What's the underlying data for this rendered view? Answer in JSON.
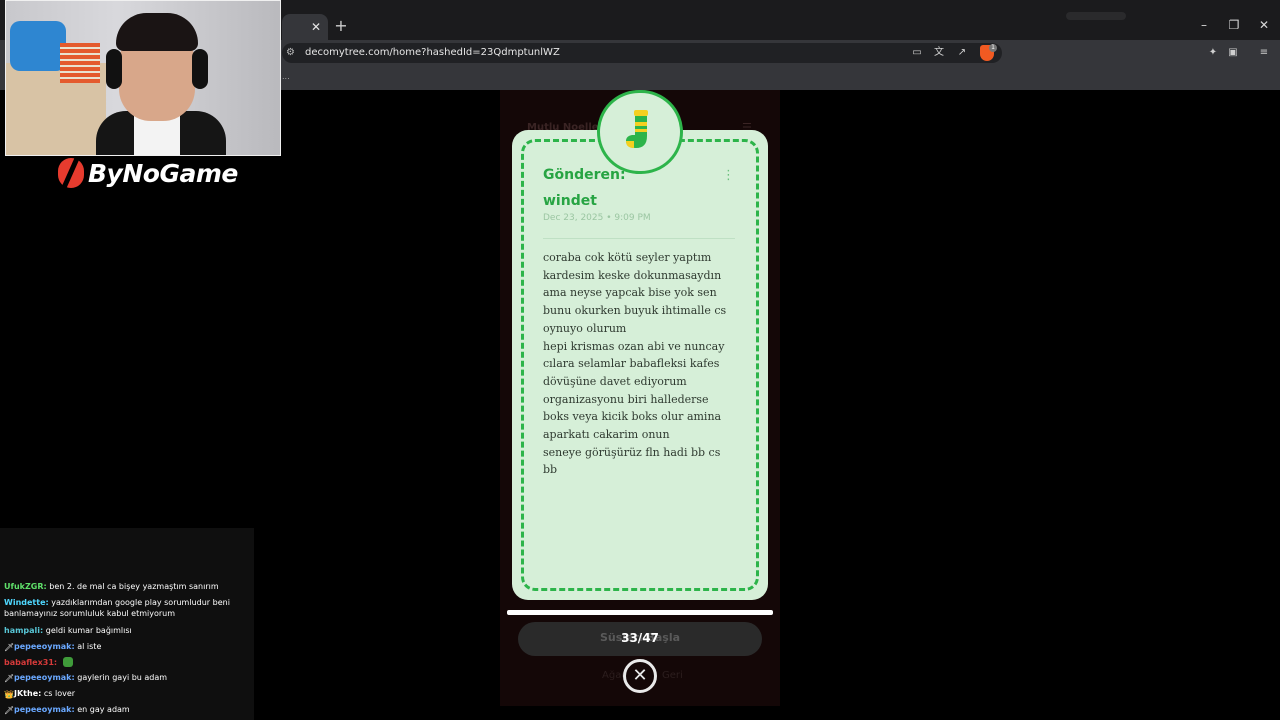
{
  "browser": {
    "tab_close": "✕",
    "new_tab": "+",
    "window_buttons": {
      "minimize": "–",
      "maximize": "❐",
      "close": "✕"
    },
    "url": "decomytree.com/home?hashedId=23QdmptunlWZ",
    "site_info_icon": "tune-icon",
    "toolbar_icons": [
      "cast-icon",
      "translate-icon",
      "share-icon",
      "brave-shield-icon",
      "extensions-icon",
      "sidebar-icon",
      "menu-icon"
    ],
    "brave_badge": "1",
    "bookmark_glyph": "..."
  },
  "page": {
    "faded_title": "Mutlu Noeller",
    "faded_menu": "☰",
    "card": {
      "sender_label": "Gönderen:",
      "sender_name": "windet",
      "timestamp": "Dec 23, 2025 • 9:09 PM",
      "menu": "⋮",
      "icon": "sock-icon",
      "message_lines": [
        "coraba cok kötü seyler yaptım",
        "kardesim keske dokunmasaydın",
        "ama neyse yapcak bise yok sen",
        "bunu okurken buyuk ihtimalle cs",
        "oynuyo olurum",
        "hepi krismas ozan abi ve nuncay",
        "cılara selamlar babafleksi kafes",
        "dövüşüne davet ediyorum",
        "organizasyonu biri hallederse",
        "boks veya kicik boks olur amina",
        "aparkatı cakarim onun",
        "seneye görüşürüz fln hadi bb cs",
        "bb"
      ]
    },
    "progress": {
      "current": 33,
      "total": 47
    },
    "counter_text": "33/47",
    "start_button_label": "Süsleri Başla",
    "close_glyph": "✕",
    "faded_links": [
      "Ağaç",
      "Geri"
    ]
  },
  "overlay": {
    "brand": "ByNoGame"
  },
  "chat": [
    {
      "user": "UfukZGR",
      "color": "#5fe06a",
      "badge": "",
      "text": "ben 2. de mal ca bişey yazmaştım sanırım"
    },
    {
      "user": "Windette",
      "color": "#4fd8ff",
      "badge": "",
      "text": "yazdıklarımdan google play sorumludur beni banlamayınız sorumluluk kabul etmiyorum"
    },
    {
      "user": "hampali",
      "color": "#58c6d6",
      "badge": "",
      "text": "geldi kumar bağımlısı"
    },
    {
      "user": "pepeeoymak",
      "color": "#6aa8ff",
      "badge": "🗡",
      "text": "al iste"
    },
    {
      "user": "babaflex31",
      "color": "#d63a3a",
      "badge": "",
      "text": ""
    },
    {
      "user": "pepeeoymak",
      "color": "#6aa8ff",
      "badge": "🗡",
      "text": "gaylerin gayi bu adam"
    },
    {
      "user": "JKthe",
      "color": "#ffffff",
      "badge": "👑",
      "text": "cs lover"
    },
    {
      "user": "pepeeoymak",
      "color": "#6aa8ff",
      "badge": "🗡",
      "text": "en gay adam"
    }
  ]
}
